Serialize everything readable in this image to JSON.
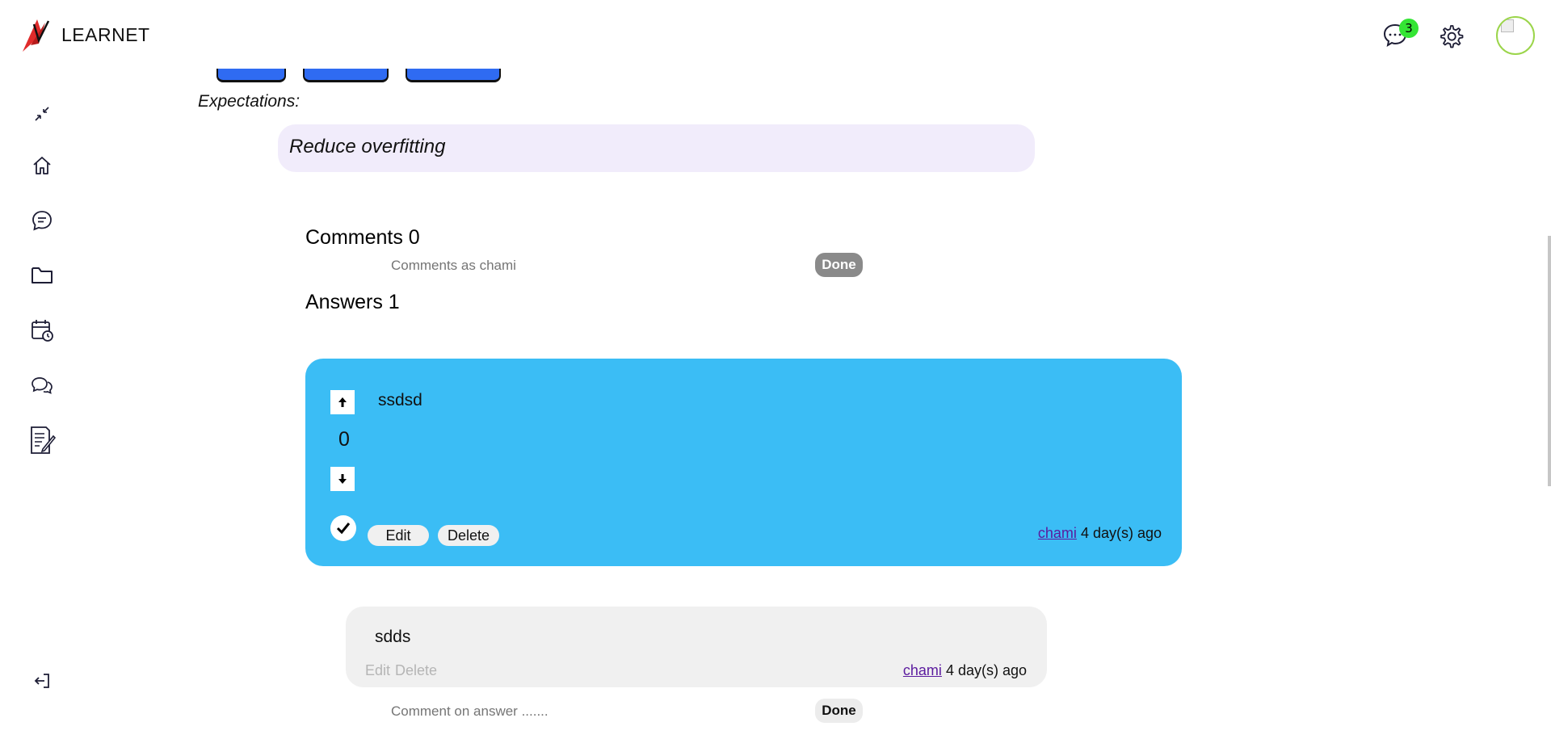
{
  "app": {
    "brand_name": "LEARNET",
    "notification_count": "3"
  },
  "colors": {
    "brand_red": "#e02b2b",
    "notification_badge": "#34e534",
    "tag_blue": "#2f6bf2",
    "expectation_bg": "#f1ecfb",
    "answer_card_bg": "#3bbdf5",
    "reply_card_bg": "#f0f0f0",
    "author_link": "#5b1a9e"
  },
  "sidebar": {
    "items": [
      {
        "name": "collapse-icon"
      },
      {
        "name": "home-icon"
      },
      {
        "name": "chat-bubble-icon"
      },
      {
        "name": "folder-icon"
      },
      {
        "name": "calendar-clock-icon"
      },
      {
        "name": "conversation-icon"
      },
      {
        "name": "notes-edit-icon"
      },
      {
        "name": "logout-icon"
      }
    ]
  },
  "question": {
    "expectations_label": "Expectations:",
    "expectations_text": "Reduce overfitting"
  },
  "comments": {
    "title": "Comments 0",
    "input_placeholder": "Comments as chami",
    "done_label": "Done"
  },
  "answers": {
    "title": "Answers 1",
    "items": [
      {
        "text": "ssdsd",
        "votes": "0",
        "edit_label": "Edit",
        "delete_label": "Delete",
        "author": "chami",
        "time": "4 day(s) ago"
      }
    ]
  },
  "answer_comments": {
    "items": [
      {
        "text": "sdds",
        "edit_label": "Edit",
        "delete_label": "Delete",
        "author": "chami",
        "time": "4 day(s) ago"
      }
    ],
    "input_placeholder": "Comment on answer .......",
    "done_label": "Done"
  }
}
